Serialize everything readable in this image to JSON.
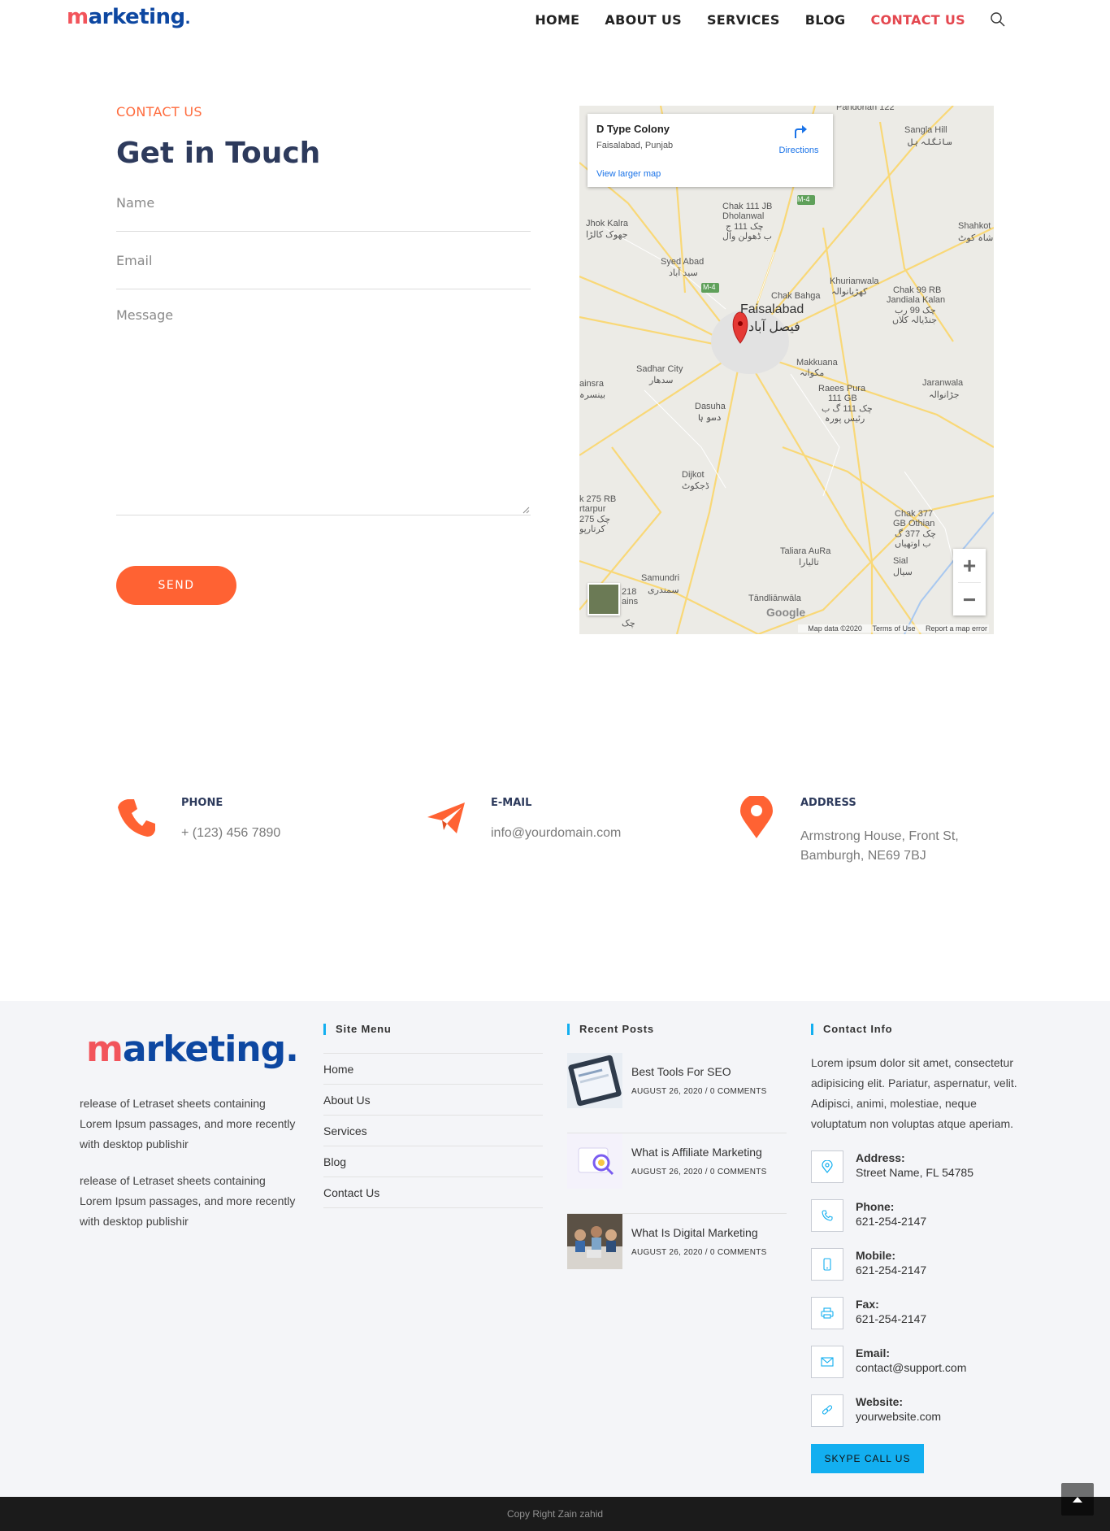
{
  "header": {
    "logo": {
      "first": "m",
      "rest": "arketing",
      "dot": "."
    },
    "nav": [
      {
        "label": "HOME"
      },
      {
        "label": "ABOUT US"
      },
      {
        "label": "SERVICES"
      },
      {
        "label": "BLOG"
      },
      {
        "label": "CONTACT US",
        "active": true
      }
    ],
    "search_icon": "search-icon"
  },
  "contact": {
    "eyebrow": "CONTACT US",
    "heading": "Get in Touch",
    "name_placeholder": "Name",
    "email_placeholder": "Email",
    "message_placeholder": "Message",
    "send_label": "SEND"
  },
  "map": {
    "place_title": "D Type Colony",
    "place_sub": "Faisalabad, Punjab",
    "directions_label": "Directions",
    "larger_map_label": "View larger map",
    "labels": {
      "pandorian": "Pandorian 122",
      "sangla": "Sangla Hill",
      "sangla_ur": "سانگلہ ہل",
      "chak111": "Chak 111 JB",
      "dholanwal": "Dholanwal",
      "chak111_ur": "چک 111 ج",
      "dholanwal_ur": "ب ڈھولن وال",
      "jhok": "Jhok Kalra",
      "jhok_ur": "جھوک کالڑا",
      "shahkot": "Shahkot",
      "shahkot_ur": "شاہ کوٹ",
      "syed": "Syed Abad",
      "syed_ur": "سید آباد",
      "khurianwala": "Khurianwala",
      "khurianwala_ur": "کھڑیانوالہ",
      "chakbahga": "Chak Bahga",
      "chak99": "Chak 99 RB",
      "jandiala": "Jandiala Kalan",
      "chak99_ur": "چک 99 رب",
      "jandiala_ur": "جنڈیالہ کلاں",
      "faisalabad": "Faisalabad",
      "faisalabad_ur": "فیصل آباد",
      "sadhar": "Sadhar City",
      "sadhar_ur": "سدھار",
      "makkuana": "Makkuana",
      "makkuana_ur": "مکوانہ",
      "ainsra": "ainsra",
      "ainsra_ur": "بینسرہ",
      "raees": "Raees Pura",
      "raees2": "111 GB",
      "raees_ur": "چک 111 گ ب",
      "raees_ur2": "رئیس پورہ",
      "jaranwala": "Jaranwala",
      "jaranwala_ur": "جڑانوالہ",
      "dasuha": "Dasuha",
      "dasuha_ur": "دسو ہا",
      "dijkot": "Dijkot",
      "dijkot_ur": "ڈجکوٹ",
      "k275": "k 275 RB",
      "kartarpur": "rtarpur",
      "k275_ur": "چک 275",
      "kartarpur_ur": "کرتارپو",
      "chak377": "Chak 377",
      "gbothian": "GB Othian",
      "chak377_ur": "چک 377 گ",
      "othian_ur": "ب اوتھیاں",
      "taliara": "Taliara AuRa",
      "taliara_ur": "تالیارا",
      "sial": "Sial",
      "sial_ur": "سیال",
      "samundri": "Samundri",
      "samundri_ur": "سمندری",
      "c218": "218",
      "c218b": "ains",
      "c218_ur": "چک",
      "tandlianwala": "Tāndliānwāla",
      "m4": "M-4"
    },
    "google": "Google",
    "footer": {
      "data": "Map data ©2020",
      "terms": "Terms of Use",
      "report": "Report a map error"
    },
    "zoom_in": "+",
    "zoom_out": "−"
  },
  "info": {
    "phone": {
      "label": "PHONE",
      "value": "+ (123) 456 7890",
      "icon": "phone-icon",
      "color": "#ff6233"
    },
    "email": {
      "label": "E-MAIL",
      "value": "info@yourdomain.com",
      "icon": "paper-plane-icon",
      "color": "#ff6233"
    },
    "address": {
      "label": "ADDRESS",
      "line1": "Armstrong House, Front St,",
      "line2": "Bamburgh, NE69 7BJ",
      "icon": "map-pin-icon",
      "color": "#ff6233"
    }
  },
  "footer": {
    "logo": {
      "first": "m",
      "rest": "arketing."
    },
    "para1": "release of Letraset sheets containing Lorem Ipsum passages, and more recently with desktop publishir",
    "para2": "release of Letraset sheets containing Lorem Ipsum passages, and more recently with desktop publishir",
    "site_menu_title": "Site Menu",
    "site_menu": [
      "Home",
      "About Us",
      "Services",
      "Blog",
      "Contact Us"
    ],
    "recent_posts_title": "Recent Posts",
    "recent_posts": [
      {
        "title": "Best Tools For SEO",
        "meta": "AUGUST 26, 2020 / 0 COMMENTS"
      },
      {
        "title": "What is Affiliate Marketing",
        "meta": "AUGUST 26, 2020 / 0 COMMENTS"
      },
      {
        "title": "What Is Digital Marketing",
        "meta": "AUGUST 26, 2020 / 0 COMMENTS"
      }
    ],
    "contact_info_title": "Contact Info",
    "contact_text": "Lorem ipsum dolor sit amet, consectetur adipisicing elit. Pariatur, aspernatur, velit. Adipisci, animi, molestiae, neque voluptatum non voluptas atque aperiam.",
    "contact_items": [
      {
        "key": "Address:",
        "value": "Street Name, FL 54785",
        "icon": "location-icon"
      },
      {
        "key": "Phone:",
        "value": "621-254-2147",
        "icon": "phone-icon"
      },
      {
        "key": "Mobile:",
        "value": "621-254-2147",
        "icon": "mobile-icon"
      },
      {
        "key": "Fax:",
        "value": "621-254-2147",
        "icon": "printer-icon"
      },
      {
        "key": "Email:",
        "value": "contact@support.com",
        "icon": "envelope-icon"
      },
      {
        "key": "Website:",
        "value": "yourwebsite.com",
        "icon": "link-icon"
      }
    ],
    "skype_label": "SKYPE CALL US",
    "copyright": "Copy Right Zain zahid",
    "accent": "#13aff0"
  }
}
